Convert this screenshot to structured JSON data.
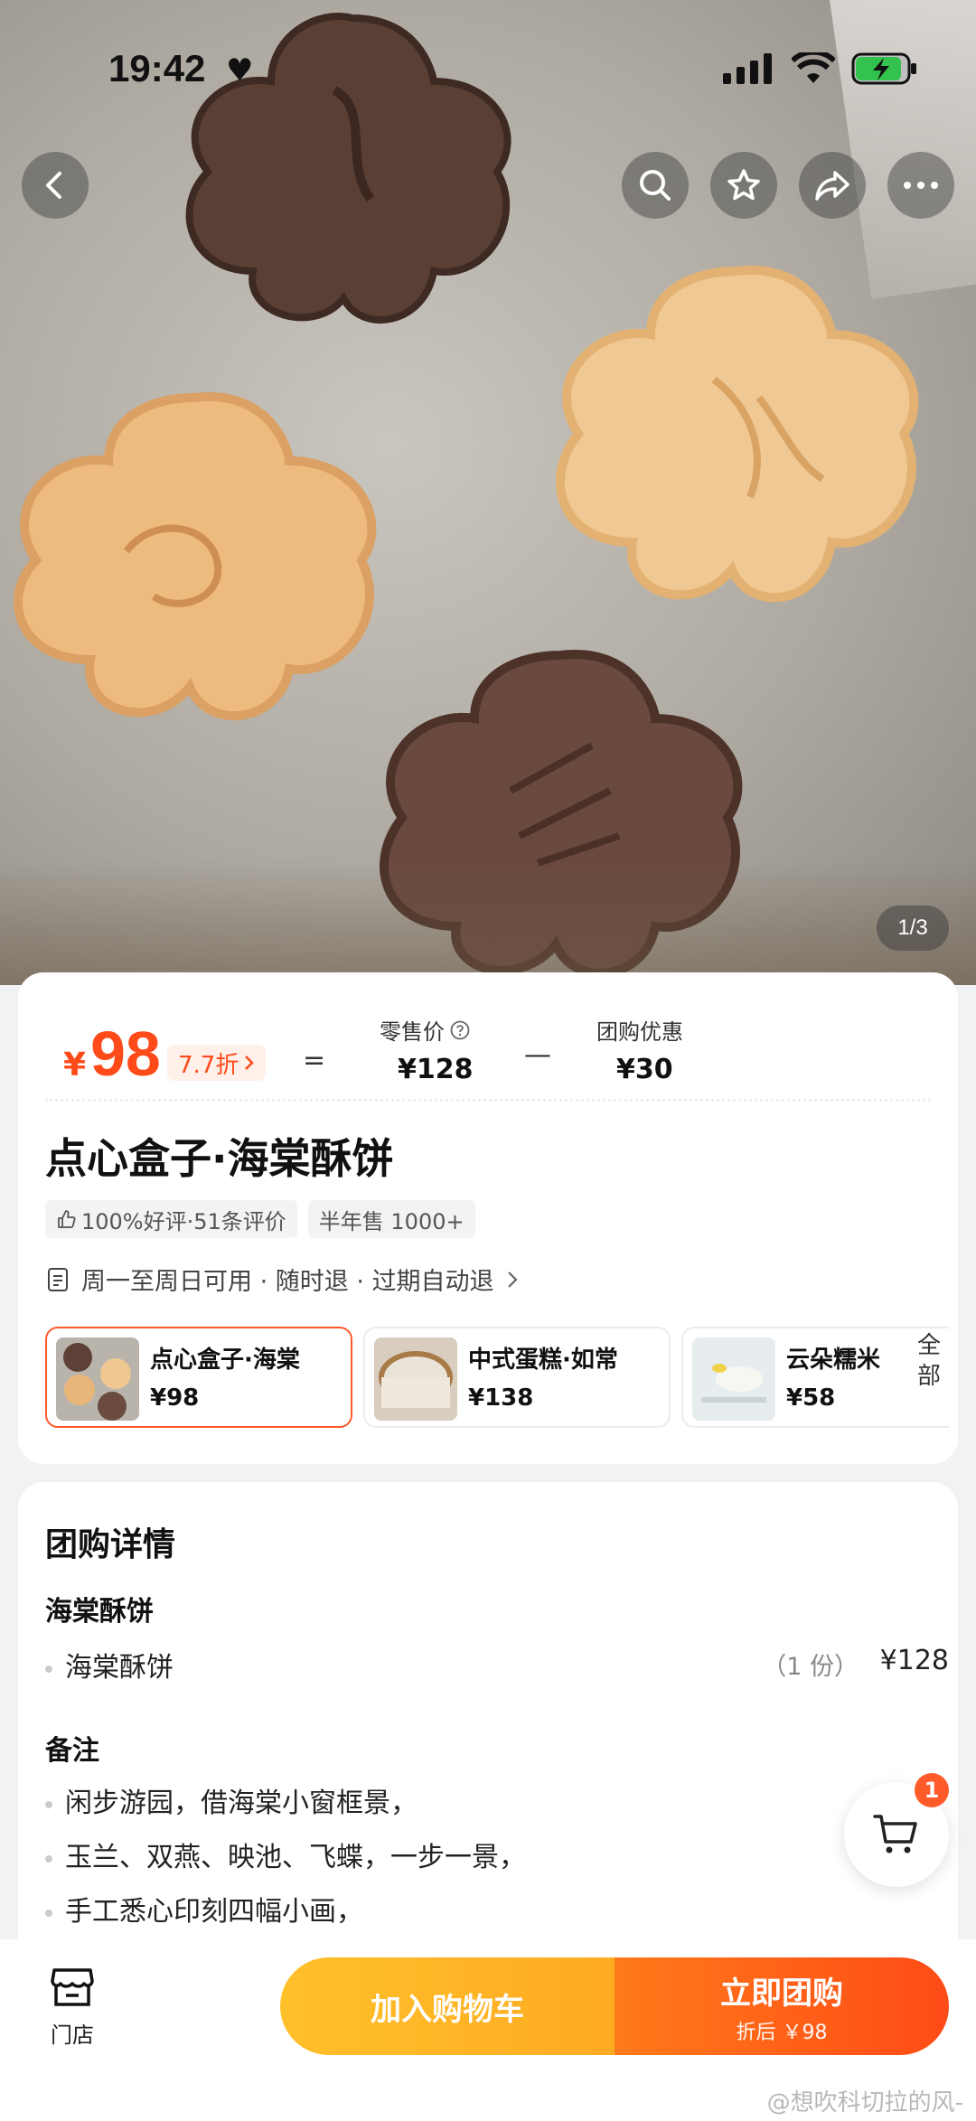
{
  "status_bar": {
    "time": "19:42",
    "heart": "♥",
    "icons": [
      "signal-icon",
      "wifi-icon",
      "battery-charging-icon"
    ]
  },
  "nav": {
    "back_icon": "back-arrow-icon",
    "search_icon": "search-icon",
    "favorite_icon": "star-icon",
    "share_icon": "share-icon",
    "more_icon": "more-icon"
  },
  "gallery": {
    "indicator": "1/3"
  },
  "price": {
    "currency": "¥",
    "amount": "98",
    "discount": "7.7折",
    "equals": "=",
    "retail_label": "零售价",
    "retail_value": "¥128",
    "minus": "—",
    "group_label": "团购优惠",
    "group_value": "¥30"
  },
  "product": {
    "title": "点心盒子·海棠酥饼",
    "tags": [
      "100%好评·51条评价",
      "半年售 1000+"
    ],
    "availability": "周一至周日可用 · 随时退 · 过期自动退"
  },
  "variants": [
    {
      "name": "点心盒子·海棠",
      "price": "¥98"
    },
    {
      "name": "中式蛋糕·如常",
      "price": "¥138"
    },
    {
      "name": "云朵糯米",
      "price": "¥58"
    }
  ],
  "variants_all": "全部",
  "details": {
    "section_title": "团购详情",
    "group_name": "海棠酥饼",
    "items": [
      {
        "name": "海棠酥饼",
        "qty": "（1 份）",
        "price": "¥128"
      }
    ],
    "notes_title": "备注",
    "notes": [
      "闲步游园，借海棠小窗框景，",
      "玉兰、双燕、映池、飞蝶，一步一景，",
      "手工悉心印刻四幅小画，"
    ]
  },
  "cart": {
    "badge": "1"
  },
  "bottom": {
    "store_label": "门店",
    "add_cart": "加入购物车",
    "buy_now": "立即团购",
    "buy_now_sub": "折后 ￥98"
  },
  "watermark": "@想吹科切拉的风-",
  "colors": {
    "accent": "#ff4a1a",
    "yellow": "#ffb526",
    "orange": "#ff5a1a"
  }
}
